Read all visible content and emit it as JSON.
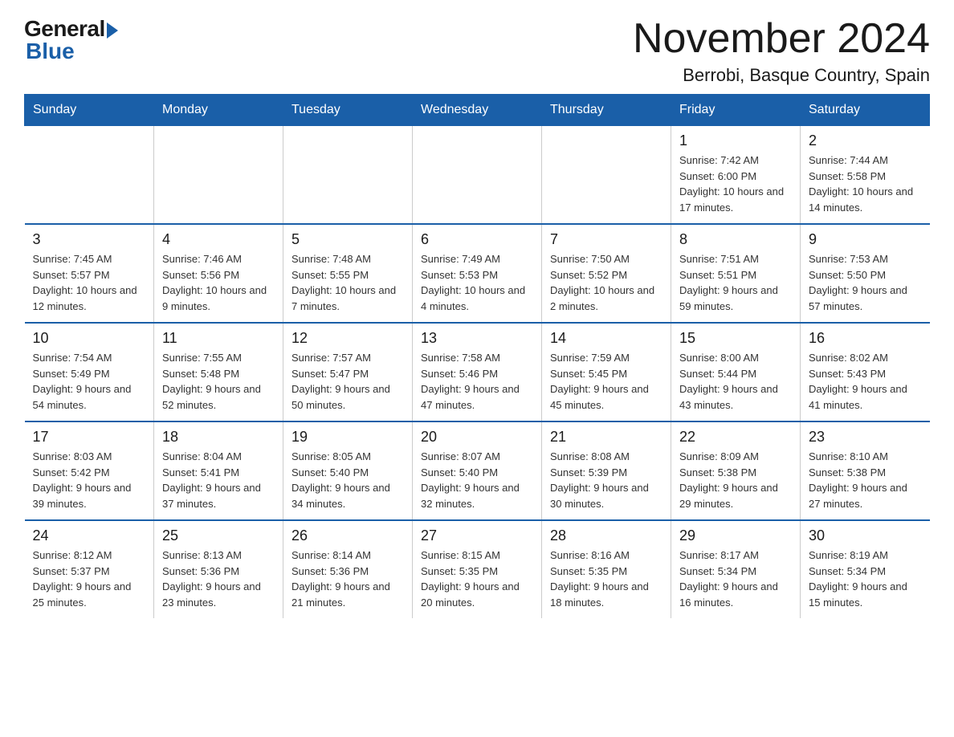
{
  "logo": {
    "general": "General",
    "blue": "Blue"
  },
  "title": "November 2024",
  "subtitle": "Berrobi, Basque Country, Spain",
  "days_of_week": [
    "Sunday",
    "Monday",
    "Tuesday",
    "Wednesday",
    "Thursday",
    "Friday",
    "Saturday"
  ],
  "weeks": [
    [
      {
        "day": "",
        "info": ""
      },
      {
        "day": "",
        "info": ""
      },
      {
        "day": "",
        "info": ""
      },
      {
        "day": "",
        "info": ""
      },
      {
        "day": "",
        "info": ""
      },
      {
        "day": "1",
        "info": "Sunrise: 7:42 AM\nSunset: 6:00 PM\nDaylight: 10 hours and 17 minutes."
      },
      {
        "day": "2",
        "info": "Sunrise: 7:44 AM\nSunset: 5:58 PM\nDaylight: 10 hours and 14 minutes."
      }
    ],
    [
      {
        "day": "3",
        "info": "Sunrise: 7:45 AM\nSunset: 5:57 PM\nDaylight: 10 hours and 12 minutes."
      },
      {
        "day": "4",
        "info": "Sunrise: 7:46 AM\nSunset: 5:56 PM\nDaylight: 10 hours and 9 minutes."
      },
      {
        "day": "5",
        "info": "Sunrise: 7:48 AM\nSunset: 5:55 PM\nDaylight: 10 hours and 7 minutes."
      },
      {
        "day": "6",
        "info": "Sunrise: 7:49 AM\nSunset: 5:53 PM\nDaylight: 10 hours and 4 minutes."
      },
      {
        "day": "7",
        "info": "Sunrise: 7:50 AM\nSunset: 5:52 PM\nDaylight: 10 hours and 2 minutes."
      },
      {
        "day": "8",
        "info": "Sunrise: 7:51 AM\nSunset: 5:51 PM\nDaylight: 9 hours and 59 minutes."
      },
      {
        "day": "9",
        "info": "Sunrise: 7:53 AM\nSunset: 5:50 PM\nDaylight: 9 hours and 57 minutes."
      }
    ],
    [
      {
        "day": "10",
        "info": "Sunrise: 7:54 AM\nSunset: 5:49 PM\nDaylight: 9 hours and 54 minutes."
      },
      {
        "day": "11",
        "info": "Sunrise: 7:55 AM\nSunset: 5:48 PM\nDaylight: 9 hours and 52 minutes."
      },
      {
        "day": "12",
        "info": "Sunrise: 7:57 AM\nSunset: 5:47 PM\nDaylight: 9 hours and 50 minutes."
      },
      {
        "day": "13",
        "info": "Sunrise: 7:58 AM\nSunset: 5:46 PM\nDaylight: 9 hours and 47 minutes."
      },
      {
        "day": "14",
        "info": "Sunrise: 7:59 AM\nSunset: 5:45 PM\nDaylight: 9 hours and 45 minutes."
      },
      {
        "day": "15",
        "info": "Sunrise: 8:00 AM\nSunset: 5:44 PM\nDaylight: 9 hours and 43 minutes."
      },
      {
        "day": "16",
        "info": "Sunrise: 8:02 AM\nSunset: 5:43 PM\nDaylight: 9 hours and 41 minutes."
      }
    ],
    [
      {
        "day": "17",
        "info": "Sunrise: 8:03 AM\nSunset: 5:42 PM\nDaylight: 9 hours and 39 minutes."
      },
      {
        "day": "18",
        "info": "Sunrise: 8:04 AM\nSunset: 5:41 PM\nDaylight: 9 hours and 37 minutes."
      },
      {
        "day": "19",
        "info": "Sunrise: 8:05 AM\nSunset: 5:40 PM\nDaylight: 9 hours and 34 minutes."
      },
      {
        "day": "20",
        "info": "Sunrise: 8:07 AM\nSunset: 5:40 PM\nDaylight: 9 hours and 32 minutes."
      },
      {
        "day": "21",
        "info": "Sunrise: 8:08 AM\nSunset: 5:39 PM\nDaylight: 9 hours and 30 minutes."
      },
      {
        "day": "22",
        "info": "Sunrise: 8:09 AM\nSunset: 5:38 PM\nDaylight: 9 hours and 29 minutes."
      },
      {
        "day": "23",
        "info": "Sunrise: 8:10 AM\nSunset: 5:38 PM\nDaylight: 9 hours and 27 minutes."
      }
    ],
    [
      {
        "day": "24",
        "info": "Sunrise: 8:12 AM\nSunset: 5:37 PM\nDaylight: 9 hours and 25 minutes."
      },
      {
        "day": "25",
        "info": "Sunrise: 8:13 AM\nSunset: 5:36 PM\nDaylight: 9 hours and 23 minutes."
      },
      {
        "day": "26",
        "info": "Sunrise: 8:14 AM\nSunset: 5:36 PM\nDaylight: 9 hours and 21 minutes."
      },
      {
        "day": "27",
        "info": "Sunrise: 8:15 AM\nSunset: 5:35 PM\nDaylight: 9 hours and 20 minutes."
      },
      {
        "day": "28",
        "info": "Sunrise: 8:16 AM\nSunset: 5:35 PM\nDaylight: 9 hours and 18 minutes."
      },
      {
        "day": "29",
        "info": "Sunrise: 8:17 AM\nSunset: 5:34 PM\nDaylight: 9 hours and 16 minutes."
      },
      {
        "day": "30",
        "info": "Sunrise: 8:19 AM\nSunset: 5:34 PM\nDaylight: 9 hours and 15 minutes."
      }
    ]
  ]
}
